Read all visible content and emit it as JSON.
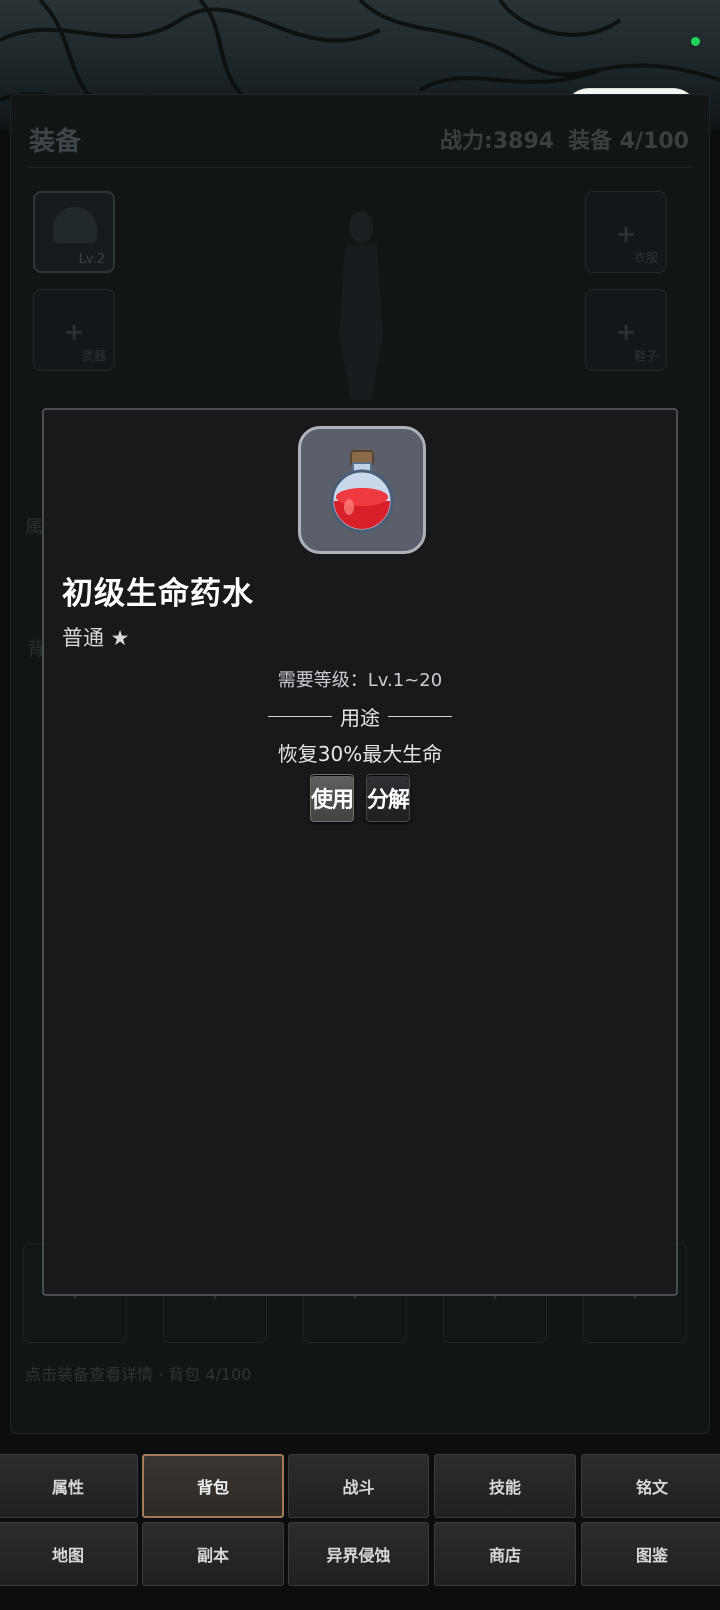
{
  "equipment_panel": {
    "title": "装备",
    "power": "战力:3894",
    "equip_count": "装备 4/100",
    "slots": {
      "helmet_level": "Lv.2",
      "clothes": "衣服",
      "weapon": "武器",
      "shoes": "鞋子"
    },
    "hint": "点击装备查看详情 · 背包 4/100"
  },
  "item_modal": {
    "name": "初级生命药水",
    "rarity": "普通 ★",
    "requirement": "需要等级：Lv.1~20",
    "usage_heading": "用途",
    "effect": "恢复30%最大生命",
    "use_button": "使用",
    "decompose_button": "分解",
    "icon": "red-potion-icon"
  },
  "bottom_nav": {
    "row1": [
      "属性",
      "背包",
      "战斗",
      "技能",
      "铭文"
    ],
    "row2": [
      "地图",
      "副本",
      "异界侵蚀",
      "商店",
      "图鉴"
    ],
    "active": "背包"
  },
  "colors": {
    "accent_active_border": "#a27b56",
    "status_dot": "#1fd45a",
    "modal_bg": "#18191b"
  }
}
